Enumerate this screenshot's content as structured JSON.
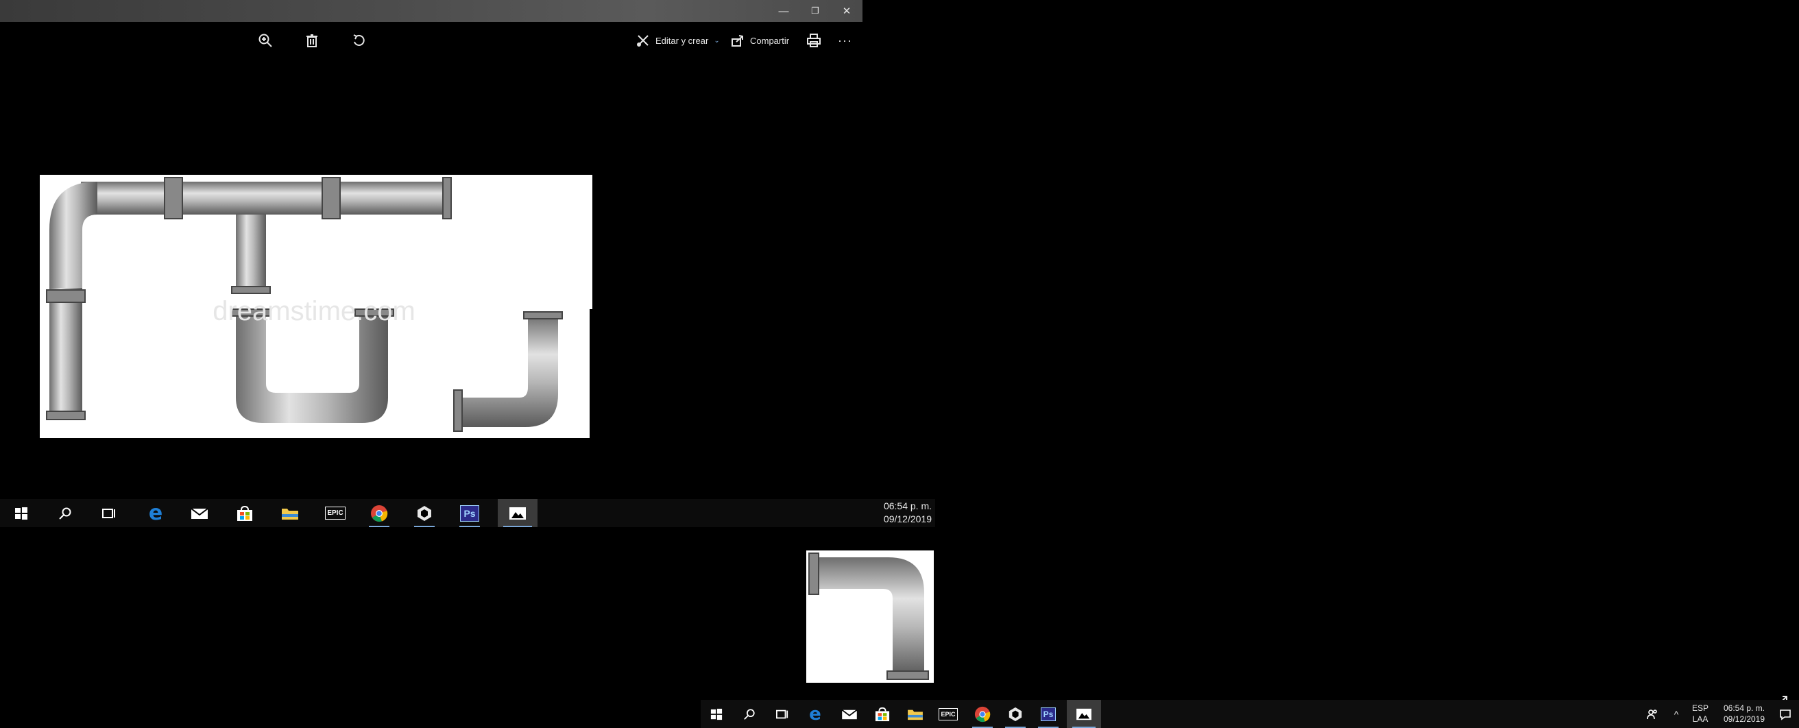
{
  "photos_window": {
    "controls": {
      "minimize": "—",
      "restore": "❐",
      "close": "✕"
    },
    "toolbar": {
      "zoom_icon": "zoom-in-icon",
      "delete_icon": "trash-icon",
      "rotate_icon": "rotate-icon",
      "edit_label": "Editar y crear",
      "share_label": "Compartir",
      "print_icon": "printer-icon",
      "more_label": "···"
    },
    "image": {
      "watermark": "dreamstime.com"
    }
  },
  "taskbar_preview": {
    "apps": [
      "windows-start",
      "search",
      "task-view",
      "edge",
      "mail",
      "store",
      "file-explorer",
      "epic-games",
      "chrome",
      "unity",
      "photoshop",
      "photos"
    ],
    "epic_label": "EPIC",
    "ps_label": "Ps",
    "time": "06:54 p. m.",
    "date": "09/12/2019"
  },
  "taskbar": {
    "epic_label": "EPIC",
    "ps_label": "Ps",
    "tray": {
      "lang_top": "ESP",
      "lang_bottom": "LAA",
      "time": "06:54 p. m.",
      "date": "09/12/2019",
      "chevron": "^"
    }
  },
  "colors": {
    "accent": "#7aa7d8",
    "edge_blue": "#1f7fd6",
    "ps_blue": "#2b2b8a",
    "folder_yellow": "#f2c94c"
  }
}
